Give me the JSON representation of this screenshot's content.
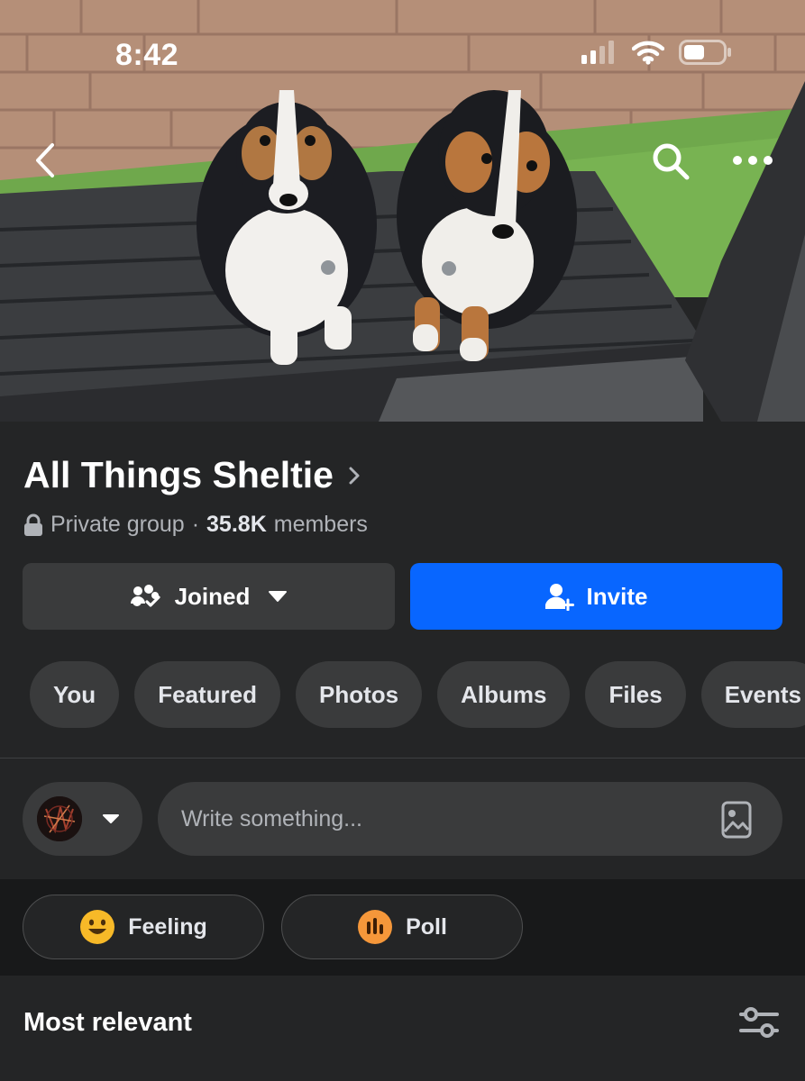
{
  "status_bar": {
    "time": "8:42"
  },
  "icons": {
    "back": "chevron-left-icon",
    "search": "search-icon",
    "more": "more-horizontal-icon",
    "title_chevron": "chevron-right-icon",
    "lock": "lock-icon",
    "joined": "group-check-icon",
    "invite": "add-person-icon",
    "photo": "photo-icon",
    "feeling": "smiley-icon",
    "poll": "poll-icon",
    "filter": "sliders-icon"
  },
  "group": {
    "name": "All Things Sheltie",
    "privacy": "Private group",
    "separator": "·",
    "member_count": "35.8K",
    "member_label": "members"
  },
  "actions": {
    "joined_label": "Joined",
    "invite_label": "Invite"
  },
  "tabs": [
    {
      "label": "You"
    },
    {
      "label": "Featured"
    },
    {
      "label": "Photos"
    },
    {
      "label": "Albums"
    },
    {
      "label": "Files"
    },
    {
      "label": "Events"
    }
  ],
  "composer": {
    "placeholder": "Write something..."
  },
  "quick_actions": {
    "feeling_label": "Feeling",
    "poll_label": "Poll"
  },
  "feed": {
    "sort_label": "Most relevant"
  },
  "colors": {
    "background": "#242526",
    "accent": "#0866ff",
    "chip": "#3a3b3c",
    "feeling": "#f7b928",
    "poll": "#f5973a"
  }
}
